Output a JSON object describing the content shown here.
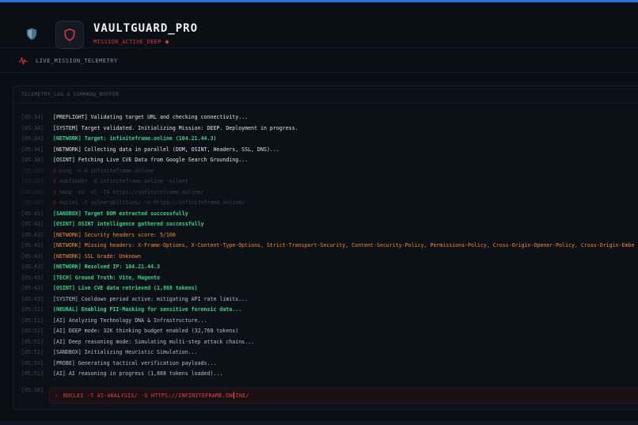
{
  "brand": {
    "title": "VAULTGUARD_PRO",
    "status": "MISSION_ACTIVE_DEEP"
  },
  "nav": {
    "section_title": "LIVE_MISSION_TELEMETRY"
  },
  "panel": {
    "title": "TELEMETRY_LOG & COMMAND_BUFFER"
  },
  "log": [
    {
      "ts": "[05:34]",
      "text": "[PREFLIGHT] Validating target URL and checking connectivity...",
      "style": "white"
    },
    {
      "ts": "[05:34]",
      "text": "[SYSTEM] Target validated. Initializing Mission: DEEP. Deployment in progress.",
      "style": "white"
    },
    {
      "ts": "[05:34]",
      "text": "[NETWORK] Target: infiniteframe.online (104.21.44.3)",
      "style": "green"
    },
    {
      "ts": "[05:34]",
      "text": "[NETWORK] Collecting data in parallel (DOM, OSINT, Headers, SSL, DNS)...",
      "style": "white"
    },
    {
      "ts": "[05:34]",
      "text": "[OSINT] Fetching Live CVE Data from Google Search Grounding...",
      "style": "white"
    },
    {
      "ts": "[05:35]",
      "text": "ping -c 4 infiniteframe.online",
      "style": "dim"
    },
    {
      "ts": "[05:35]",
      "text": "subfinder -d infiniteframe.online -silent",
      "style": "dim"
    },
    {
      "ts": "[05:35]",
      "text": "nmap -sV -sC -T4 https://infiniteframe.online/",
      "style": "dim"
    },
    {
      "ts": "[05:35]",
      "text": "nuclei -t vulnerabilities/ -u https://infiniteframe.online/",
      "style": "dim"
    },
    {
      "ts": "[05:43]",
      "text": "[SANDBOX] Target DOM extracted successfully",
      "style": "green"
    },
    {
      "ts": "[05:43]",
      "text": "[OSINT] OSINT intelligence gathered successfully",
      "style": "green"
    },
    {
      "ts": "[05:43]",
      "text": "[NETWORK] Security headers score: 5/100",
      "style": "orange"
    },
    {
      "ts": "[05:43]",
      "text": "[NETWORK] Missing headers: X-Frame-Options, X-Content-Type-Options, Strict-Transport-Security, Content-Security-Policy, Permissions-Policy, Cross-Origin-Opener-Policy, Cross-Origin-Embe",
      "style": "orange"
    },
    {
      "ts": "[05:43]",
      "text": "[NETWORK] SSL Grade: Unknown",
      "style": "orange"
    },
    {
      "ts": "[05:43]",
      "text": "[NETWORK] Resolved IP: 104.21.44.3",
      "style": "green"
    },
    {
      "ts": "[05:43]",
      "text": "[TECH] Ground Truth: Vite, Magento",
      "style": "green"
    },
    {
      "ts": "[05:43]",
      "text": "[OSINT] Live CVE data retrieved (1,868 tokens)",
      "style": "green"
    },
    {
      "ts": "[05:43]",
      "text": "[SYSTEM] Cooldown period active: mitigating API rate limits...",
      "style": "gray"
    },
    {
      "ts": "[05:51]",
      "text": "[NEURAL] Enabling PII-Masking for sensitive forensic data...",
      "style": "green"
    },
    {
      "ts": "[05:51]",
      "text": "[AI] Analyzing Technology DNA & Infrastructure...",
      "style": "gray"
    },
    {
      "ts": "[05:51]",
      "text": "[AI] DEEP mode: 32K thinking budget enabled (32,768 tokens)",
      "style": "gray"
    },
    {
      "ts": "[05:51]",
      "text": "[AI] Deep reasoning mode: Simulating multi-step attack chains...",
      "style": "gray"
    },
    {
      "ts": "[05:51]",
      "text": "[SANDBOX] Initializing Heuristic Simulation...",
      "style": "gray"
    },
    {
      "ts": "[05:51]",
      "text": "[PROBE] Generating tactical verification payloads...",
      "style": "gray"
    },
    {
      "ts": "[05:51]",
      "text": "[AI] AI reasoning in progress (1,868 tokens loaded)...",
      "style": "gray"
    }
  ],
  "command": {
    "ts": "[05:50]",
    "caret": "›",
    "text": "NUCLEI -T AI-ANALYSIS/ -U HTTPS://INFINITEFRAME.ONLINE/"
  },
  "icons": {
    "brand_shield": "shield-icon",
    "logo": "shield-outline-icon",
    "telemetry": "pulse-icon"
  },
  "colors": {
    "accent_red": "#d0383a",
    "success_green": "#2fd58a",
    "warning_orange": "#f08a2a",
    "top_bar_blue": "#2a6fdb"
  }
}
